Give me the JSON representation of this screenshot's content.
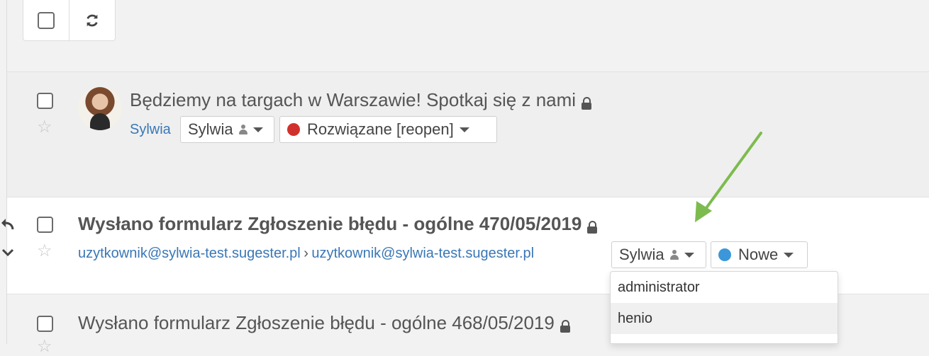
{
  "toolbar": {
    "select_all_icon": "checkbox-icon",
    "refresh_icon": "refresh-icon"
  },
  "rows": [
    {
      "subject": "Będziemy na targach w Warszawie! Spotkaj się z nami",
      "sender": "Sylwia",
      "assignee": "Sylwia",
      "status": "Rozwiązane [reopen]",
      "status_color": "#d0312d"
    },
    {
      "subject": "Wysłano formularz Zgłoszenie błędu - ogólne 470/05/2019",
      "from": "uzytkownik@sylwia-test.sugester.pl",
      "separator": "›",
      "to": "uzytkownik@sylwia-test.sugester.pl",
      "assignee": "Sylwia",
      "status": "Nowe",
      "status_color": "#3b97d9"
    },
    {
      "subject": "Wysłano formularz Zgłoszenie błędu - ogólne 468/05/2019"
    }
  ],
  "assignee_menu": {
    "options": [
      "administrator",
      "henio"
    ],
    "highlighted": "henio"
  },
  "colors": {
    "accent_link": "#3a77b6",
    "annotation_arrow": "#7dbb4f"
  }
}
